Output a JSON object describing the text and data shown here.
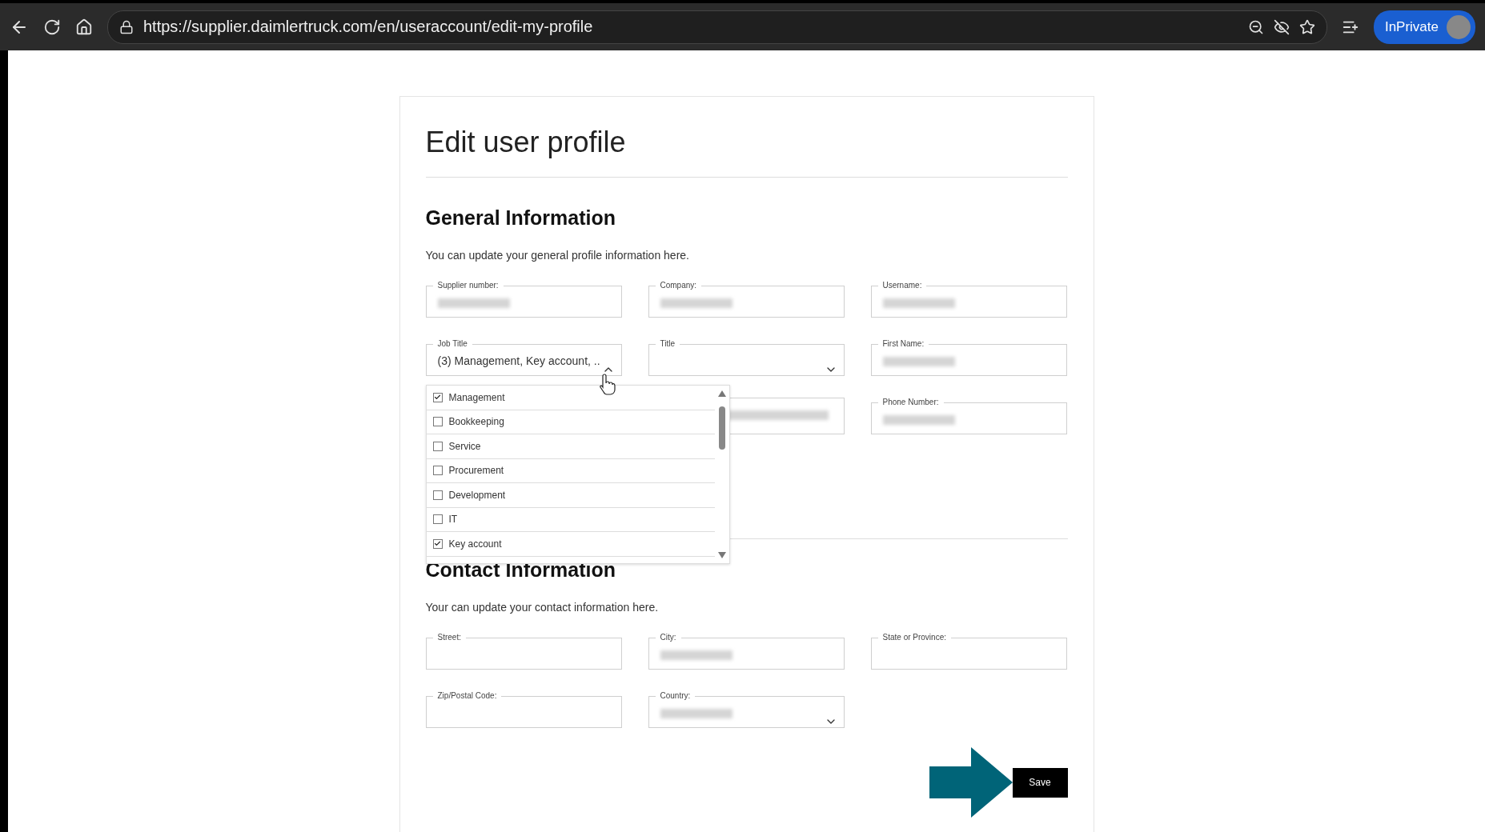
{
  "browser": {
    "url": "https://supplier.daimlertruck.com/en/useraccount/edit-my-profile",
    "profile_label": "InPrivate"
  },
  "page_title": "Edit user profile",
  "general": {
    "heading": "General Information",
    "description": "You can update your general profile information here.",
    "fields": [
      {
        "kind": "text",
        "label": "Supplier number:",
        "blurred": true
      },
      {
        "kind": "text",
        "label": "Company:",
        "blurred": true
      },
      {
        "kind": "text",
        "label": "Username:",
        "blurred": true
      },
      {
        "kind": "multiselect",
        "label": "Job Title",
        "value": "(3) Management, Key account, ..",
        "expanded": true,
        "options": [
          {
            "label": "Management",
            "checked": true
          },
          {
            "label": "Bookkeeping",
            "checked": false
          },
          {
            "label": "Service",
            "checked": false
          },
          {
            "label": "Procurement",
            "checked": false
          },
          {
            "label": "Development",
            "checked": false
          },
          {
            "label": "IT",
            "checked": false
          },
          {
            "label": "Key account",
            "checked": true
          }
        ]
      },
      {
        "kind": "select",
        "label": "Title",
        "blurred": false
      },
      {
        "kind": "text",
        "label": "First Name:",
        "blurred": true
      },
      {
        "kind": "hidden"
      },
      {
        "kind": "text",
        "blurred": true
      },
      {
        "kind": "text",
        "label": "Phone Number:",
        "blurred": true
      }
    ]
  },
  "contact": {
    "heading": "Contact Information",
    "description": "Your can update your contact information here.",
    "fields": [
      {
        "kind": "text",
        "label": "Street:",
        "blurred": false
      },
      {
        "kind": "text",
        "label": "City:",
        "blurred": true
      },
      {
        "kind": "text",
        "label": "State or Province:",
        "blurred": false
      },
      {
        "kind": "text",
        "label": "Zip/Postal Code:",
        "blurred": false
      },
      {
        "kind": "select",
        "label": "Country:",
        "blurred": true
      }
    ]
  },
  "save_button": "Save"
}
